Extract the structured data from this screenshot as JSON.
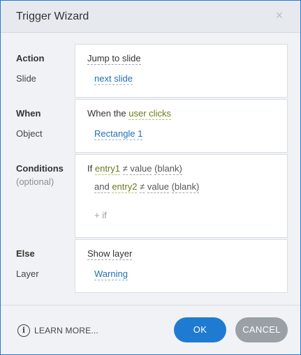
{
  "dialog": {
    "title": "Trigger Wizard",
    "close_icon": "×"
  },
  "action": {
    "label": "Action",
    "value": "Jump to slide",
    "sub_label": "Slide",
    "sub_value": "next slide"
  },
  "when": {
    "label": "When",
    "prefix": "When the",
    "event": "user clicks",
    "sub_label": "Object",
    "sub_value": "Rectangle 1"
  },
  "conditions": {
    "label": "Conditions",
    "hint": "(optional)",
    "line1": {
      "prefix": "If",
      "variable": "entry1",
      "operator": "≠",
      "compare_type": "value",
      "value": "(blank)"
    },
    "line2": {
      "prefix": "and",
      "variable": "entry2",
      "operator": "≠",
      "compare_type": "value",
      "value": "(blank)"
    },
    "add_if": "+ if"
  },
  "else": {
    "label": "Else",
    "value": "Show layer",
    "sub_label": "Layer",
    "sub_value": "Warning"
  },
  "footer": {
    "info_icon": "i",
    "learn_more": "LEARN MORE...",
    "ok": "OK",
    "cancel": "CANCEL"
  }
}
